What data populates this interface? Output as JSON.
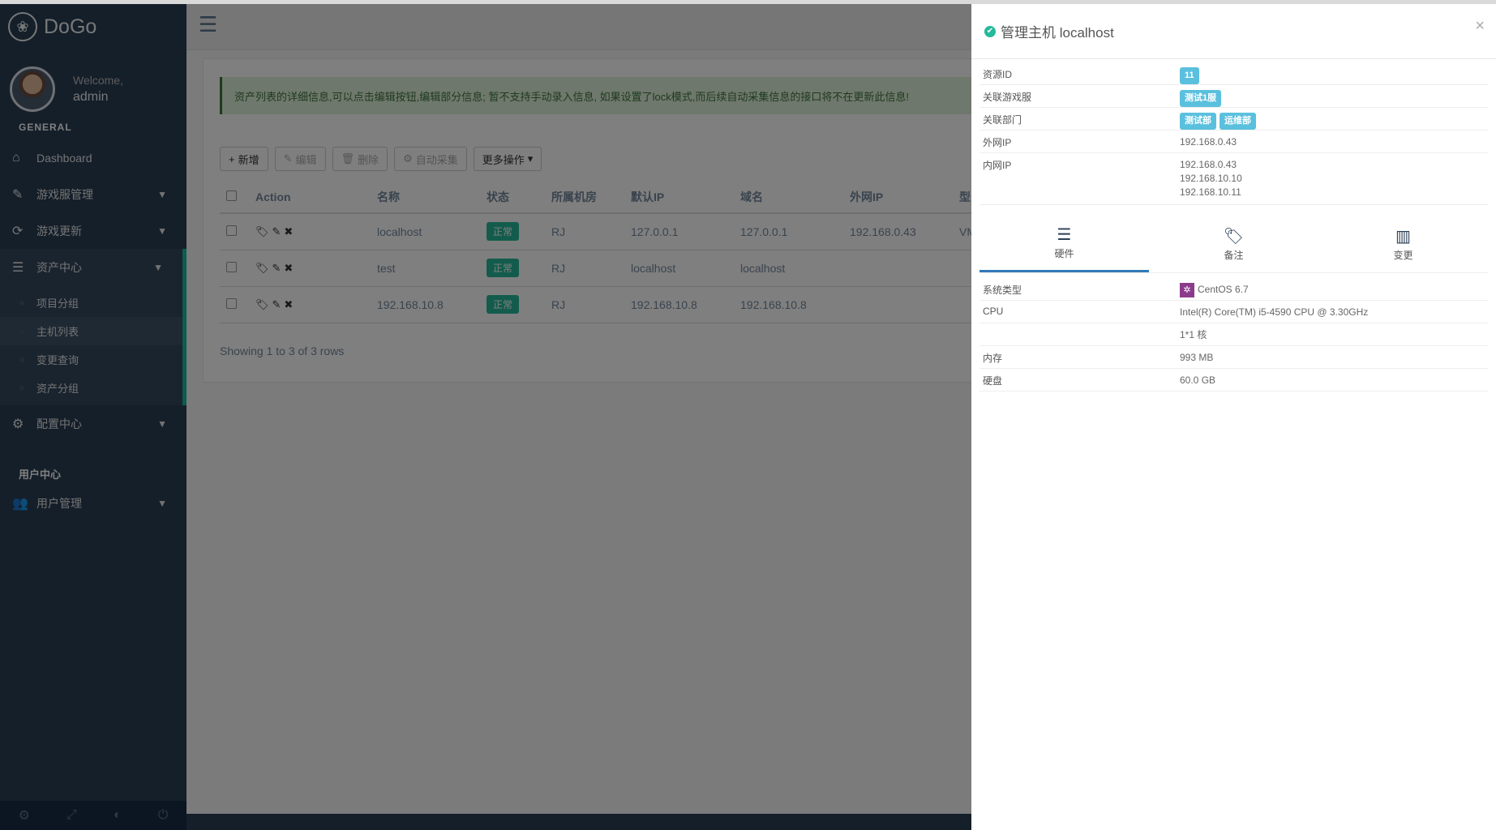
{
  "sidebar": {
    "brand": "DoGo",
    "welcome": "Welcome,",
    "username": "admin",
    "section_general": "GENERAL",
    "items": [
      {
        "label": "Dashboard"
      },
      {
        "label": "游戏服管理"
      },
      {
        "label": "游戏更新"
      },
      {
        "label": "资产中心"
      },
      {
        "label": "配置中心"
      }
    ],
    "subitems": [
      {
        "label": "项目分组"
      },
      {
        "label": "主机列表"
      },
      {
        "label": "变更查询"
      },
      {
        "label": "资产分组"
      }
    ],
    "section_user": "用户中心",
    "user_mgmt": "用户管理"
  },
  "main": {
    "alert": "资产列表的详细信息,可以点击编辑按钮,编辑部分信息; 暂不支持手动录入信息, 如果设置了lock模式,而后续自动采集信息的接口将不在更新此信息!",
    "toolbar": {
      "add": "新增",
      "edit": "编辑",
      "delete": "删除",
      "auto": "自动采集",
      "more": "更多操作"
    },
    "table": {
      "headers": [
        "Action",
        "名称",
        "状态",
        "所属机房",
        "默认IP",
        "域名",
        "外网IP",
        "型号"
      ],
      "rows": [
        {
          "name": "localhost",
          "status": "正常",
          "idc": "RJ",
          "ip": "127.0.0.1",
          "domain": "127.0.0.1",
          "wan": "192.168.0.43",
          "model": "VM"
        },
        {
          "name": "test",
          "status": "正常",
          "idc": "RJ",
          "ip": "localhost",
          "domain": "localhost",
          "wan": "",
          "model": ""
        },
        {
          "name": "192.168.10.8",
          "status": "正常",
          "idc": "RJ",
          "ip": "192.168.10.8",
          "domain": "192.168.10.8",
          "wan": "",
          "model": ""
        }
      ]
    },
    "showing": "Showing 1 to 3 of 3 rows"
  },
  "drawer": {
    "title": "管理主机 localhost",
    "close": "×",
    "info": {
      "id_label": "资源ID",
      "id_value": "11",
      "game_label": "关联游戏服",
      "game_tag": "测试1服",
      "dept_label": "关联部门",
      "dept_tags": [
        "测试部",
        "运维部"
      ],
      "wan_label": "外网IP",
      "wan_value": "192.168.0.43",
      "lan_label": "内网IP",
      "lan_values": [
        "192.168.0.43",
        "192.168.10.10",
        "192.168.10.11"
      ]
    },
    "tabs": [
      "硬件",
      "备注",
      "变更"
    ],
    "hardware": {
      "os_label": "系统类型",
      "os_value": "CentOS 6.7",
      "cpu_label": "CPU",
      "cpu_value": "Intel(R) Core(TM) i5-4590 CPU @ 3.30GHz",
      "cpu_cores": "1*1 核",
      "mem_label": "内存",
      "mem_value": "993 MB",
      "disk_label": "硬盘",
      "disk_value": "60.0 GB"
    }
  },
  "colors": {
    "sidebar": "#2a3f54",
    "accent": "#1abb9c",
    "ok": "#26b99a",
    "tag": "#5bc0de"
  }
}
